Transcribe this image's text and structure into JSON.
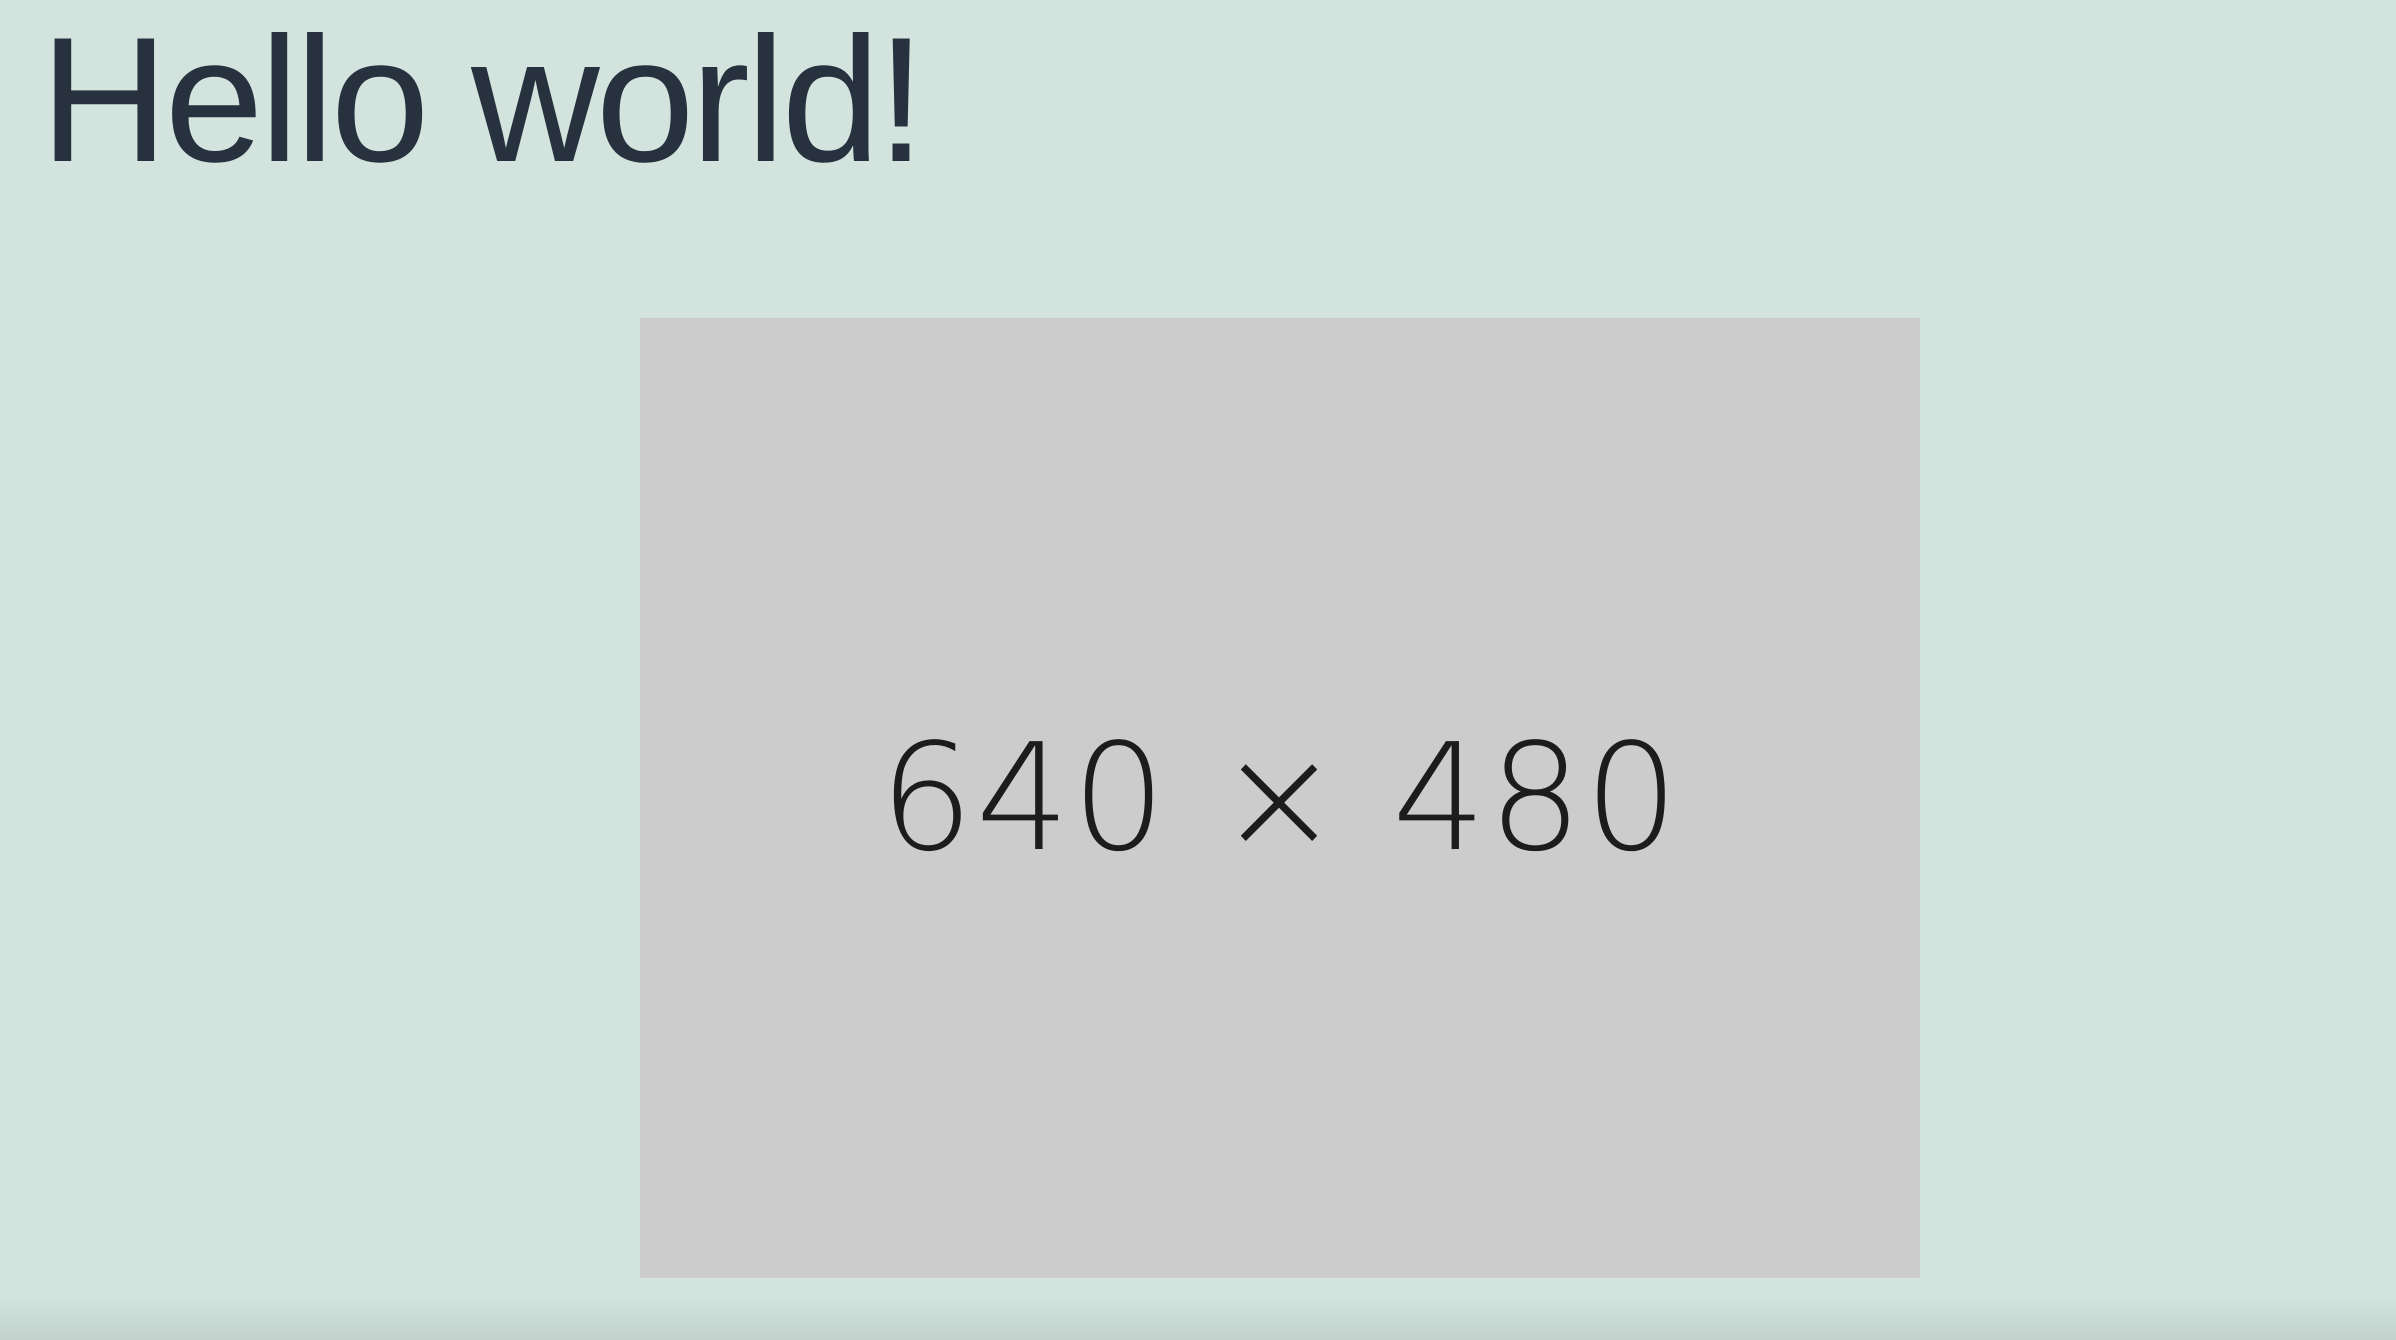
{
  "page": {
    "title": "Hello world!",
    "background_color": "#d3e4df",
    "text_color": "#28323f"
  },
  "placeholder": {
    "label": "640 × 480",
    "fill_color": "#cccccc"
  }
}
